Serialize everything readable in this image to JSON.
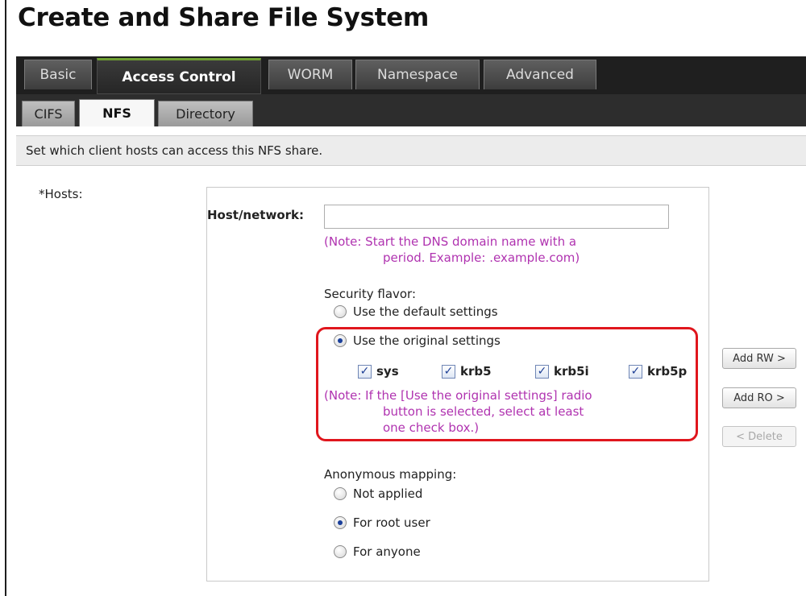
{
  "window": {
    "title": "Create and Share File System"
  },
  "tabs": [
    {
      "label": "Basic",
      "active": false
    },
    {
      "label": "Access Control",
      "active": true
    },
    {
      "label": "WORM",
      "active": false
    },
    {
      "label": "Namespace",
      "active": false
    },
    {
      "label": "Advanced",
      "active": false
    }
  ],
  "subtabs": [
    {
      "label": "CIFS",
      "active": false
    },
    {
      "label": "NFS",
      "active": true
    },
    {
      "label": "Directory",
      "active": false
    }
  ],
  "description": "Set which client hosts can access this NFS share.",
  "form": {
    "hosts_label": "*Hosts:",
    "host_network": {
      "label": "Host/network:",
      "value": "",
      "placeholder": ""
    },
    "host_note_line1": "(Note: Start the DNS domain name with a",
    "host_note_line2": "period. Example: .example.com)",
    "security_flavor": {
      "label": "Security flavor:",
      "options": [
        {
          "label": "Use the default settings",
          "selected": false
        },
        {
          "label": "Use the original settings",
          "selected": true
        }
      ],
      "checkboxes": [
        {
          "label": "sys",
          "checked": true
        },
        {
          "label": "krb5",
          "checked": true
        },
        {
          "label": "krb5i",
          "checked": true
        },
        {
          "label": "krb5p",
          "checked": true
        }
      ],
      "note_line1": "(Note: If the [Use the original settings] radio",
      "note_line2": "button is selected, select at least",
      "note_line3": "one check box.)"
    },
    "anonymous_mapping": {
      "label": "Anonymous mapping:",
      "options": [
        {
          "label": "Not applied",
          "selected": false
        },
        {
          "label": "For root user",
          "selected": true
        },
        {
          "label": "For anyone",
          "selected": false
        }
      ]
    }
  },
  "buttons": {
    "add_rw": "Add RW >",
    "add_ro": "Add RO >",
    "delete": "< Delete"
  },
  "colors": {
    "note": "#b033b0",
    "highlight": "#e0161d",
    "active_tab_accent": "#6fa032",
    "tabbar_bg": "#1f1f1f"
  },
  "icons": {
    "check": "✓"
  }
}
